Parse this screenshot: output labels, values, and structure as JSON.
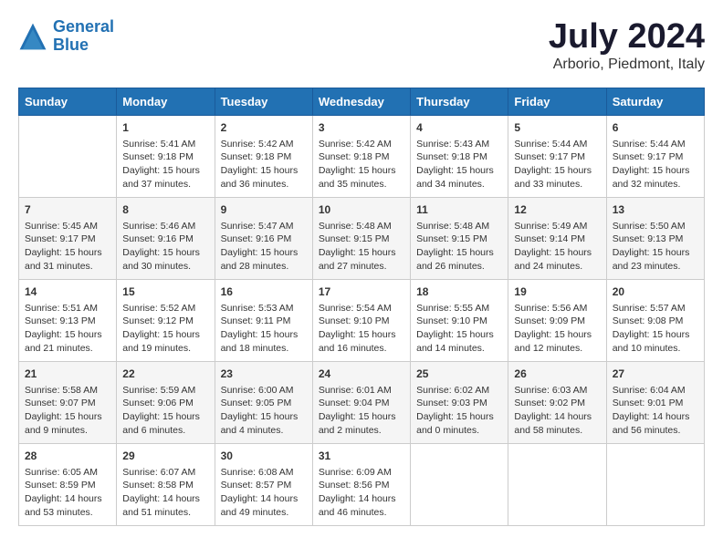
{
  "header": {
    "logo_line1": "General",
    "logo_line2": "Blue",
    "month_year": "July 2024",
    "location": "Arborio, Piedmont, Italy"
  },
  "weekdays": [
    "Sunday",
    "Monday",
    "Tuesday",
    "Wednesday",
    "Thursday",
    "Friday",
    "Saturday"
  ],
  "weeks": [
    [
      {
        "day": "",
        "sunrise": "",
        "sunset": "",
        "daylight": ""
      },
      {
        "day": "1",
        "sunrise": "Sunrise: 5:41 AM",
        "sunset": "Sunset: 9:18 PM",
        "daylight": "Daylight: 15 hours and 37 minutes."
      },
      {
        "day": "2",
        "sunrise": "Sunrise: 5:42 AM",
        "sunset": "Sunset: 9:18 PM",
        "daylight": "Daylight: 15 hours and 36 minutes."
      },
      {
        "day": "3",
        "sunrise": "Sunrise: 5:42 AM",
        "sunset": "Sunset: 9:18 PM",
        "daylight": "Daylight: 15 hours and 35 minutes."
      },
      {
        "day": "4",
        "sunrise": "Sunrise: 5:43 AM",
        "sunset": "Sunset: 9:18 PM",
        "daylight": "Daylight: 15 hours and 34 minutes."
      },
      {
        "day": "5",
        "sunrise": "Sunrise: 5:44 AM",
        "sunset": "Sunset: 9:17 PM",
        "daylight": "Daylight: 15 hours and 33 minutes."
      },
      {
        "day": "6",
        "sunrise": "Sunrise: 5:44 AM",
        "sunset": "Sunset: 9:17 PM",
        "daylight": "Daylight: 15 hours and 32 minutes."
      }
    ],
    [
      {
        "day": "7",
        "sunrise": "Sunrise: 5:45 AM",
        "sunset": "Sunset: 9:17 PM",
        "daylight": "Daylight: 15 hours and 31 minutes."
      },
      {
        "day": "8",
        "sunrise": "Sunrise: 5:46 AM",
        "sunset": "Sunset: 9:16 PM",
        "daylight": "Daylight: 15 hours and 30 minutes."
      },
      {
        "day": "9",
        "sunrise": "Sunrise: 5:47 AM",
        "sunset": "Sunset: 9:16 PM",
        "daylight": "Daylight: 15 hours and 28 minutes."
      },
      {
        "day": "10",
        "sunrise": "Sunrise: 5:48 AM",
        "sunset": "Sunset: 9:15 PM",
        "daylight": "Daylight: 15 hours and 27 minutes."
      },
      {
        "day": "11",
        "sunrise": "Sunrise: 5:48 AM",
        "sunset": "Sunset: 9:15 PM",
        "daylight": "Daylight: 15 hours and 26 minutes."
      },
      {
        "day": "12",
        "sunrise": "Sunrise: 5:49 AM",
        "sunset": "Sunset: 9:14 PM",
        "daylight": "Daylight: 15 hours and 24 minutes."
      },
      {
        "day": "13",
        "sunrise": "Sunrise: 5:50 AM",
        "sunset": "Sunset: 9:13 PM",
        "daylight": "Daylight: 15 hours and 23 minutes."
      }
    ],
    [
      {
        "day": "14",
        "sunrise": "Sunrise: 5:51 AM",
        "sunset": "Sunset: 9:13 PM",
        "daylight": "Daylight: 15 hours and 21 minutes."
      },
      {
        "day": "15",
        "sunrise": "Sunrise: 5:52 AM",
        "sunset": "Sunset: 9:12 PM",
        "daylight": "Daylight: 15 hours and 19 minutes."
      },
      {
        "day": "16",
        "sunrise": "Sunrise: 5:53 AM",
        "sunset": "Sunset: 9:11 PM",
        "daylight": "Daylight: 15 hours and 18 minutes."
      },
      {
        "day": "17",
        "sunrise": "Sunrise: 5:54 AM",
        "sunset": "Sunset: 9:10 PM",
        "daylight": "Daylight: 15 hours and 16 minutes."
      },
      {
        "day": "18",
        "sunrise": "Sunrise: 5:55 AM",
        "sunset": "Sunset: 9:10 PM",
        "daylight": "Daylight: 15 hours and 14 minutes."
      },
      {
        "day": "19",
        "sunrise": "Sunrise: 5:56 AM",
        "sunset": "Sunset: 9:09 PM",
        "daylight": "Daylight: 15 hours and 12 minutes."
      },
      {
        "day": "20",
        "sunrise": "Sunrise: 5:57 AM",
        "sunset": "Sunset: 9:08 PM",
        "daylight": "Daylight: 15 hours and 10 minutes."
      }
    ],
    [
      {
        "day": "21",
        "sunrise": "Sunrise: 5:58 AM",
        "sunset": "Sunset: 9:07 PM",
        "daylight": "Daylight: 15 hours and 9 minutes."
      },
      {
        "day": "22",
        "sunrise": "Sunrise: 5:59 AM",
        "sunset": "Sunset: 9:06 PM",
        "daylight": "Daylight: 15 hours and 6 minutes."
      },
      {
        "day": "23",
        "sunrise": "Sunrise: 6:00 AM",
        "sunset": "Sunset: 9:05 PM",
        "daylight": "Daylight: 15 hours and 4 minutes."
      },
      {
        "day": "24",
        "sunrise": "Sunrise: 6:01 AM",
        "sunset": "Sunset: 9:04 PM",
        "daylight": "Daylight: 15 hours and 2 minutes."
      },
      {
        "day": "25",
        "sunrise": "Sunrise: 6:02 AM",
        "sunset": "Sunset: 9:03 PM",
        "daylight": "Daylight: 15 hours and 0 minutes."
      },
      {
        "day": "26",
        "sunrise": "Sunrise: 6:03 AM",
        "sunset": "Sunset: 9:02 PM",
        "daylight": "Daylight: 14 hours and 58 minutes."
      },
      {
        "day": "27",
        "sunrise": "Sunrise: 6:04 AM",
        "sunset": "Sunset: 9:01 PM",
        "daylight": "Daylight: 14 hours and 56 minutes."
      }
    ],
    [
      {
        "day": "28",
        "sunrise": "Sunrise: 6:05 AM",
        "sunset": "Sunset: 8:59 PM",
        "daylight": "Daylight: 14 hours and 53 minutes."
      },
      {
        "day": "29",
        "sunrise": "Sunrise: 6:07 AM",
        "sunset": "Sunset: 8:58 PM",
        "daylight": "Daylight: 14 hours and 51 minutes."
      },
      {
        "day": "30",
        "sunrise": "Sunrise: 6:08 AM",
        "sunset": "Sunset: 8:57 PM",
        "daylight": "Daylight: 14 hours and 49 minutes."
      },
      {
        "day": "31",
        "sunrise": "Sunrise: 6:09 AM",
        "sunset": "Sunset: 8:56 PM",
        "daylight": "Daylight: 14 hours and 46 minutes."
      },
      {
        "day": "",
        "sunrise": "",
        "sunset": "",
        "daylight": ""
      },
      {
        "day": "",
        "sunrise": "",
        "sunset": "",
        "daylight": ""
      },
      {
        "day": "",
        "sunrise": "",
        "sunset": "",
        "daylight": ""
      }
    ]
  ]
}
